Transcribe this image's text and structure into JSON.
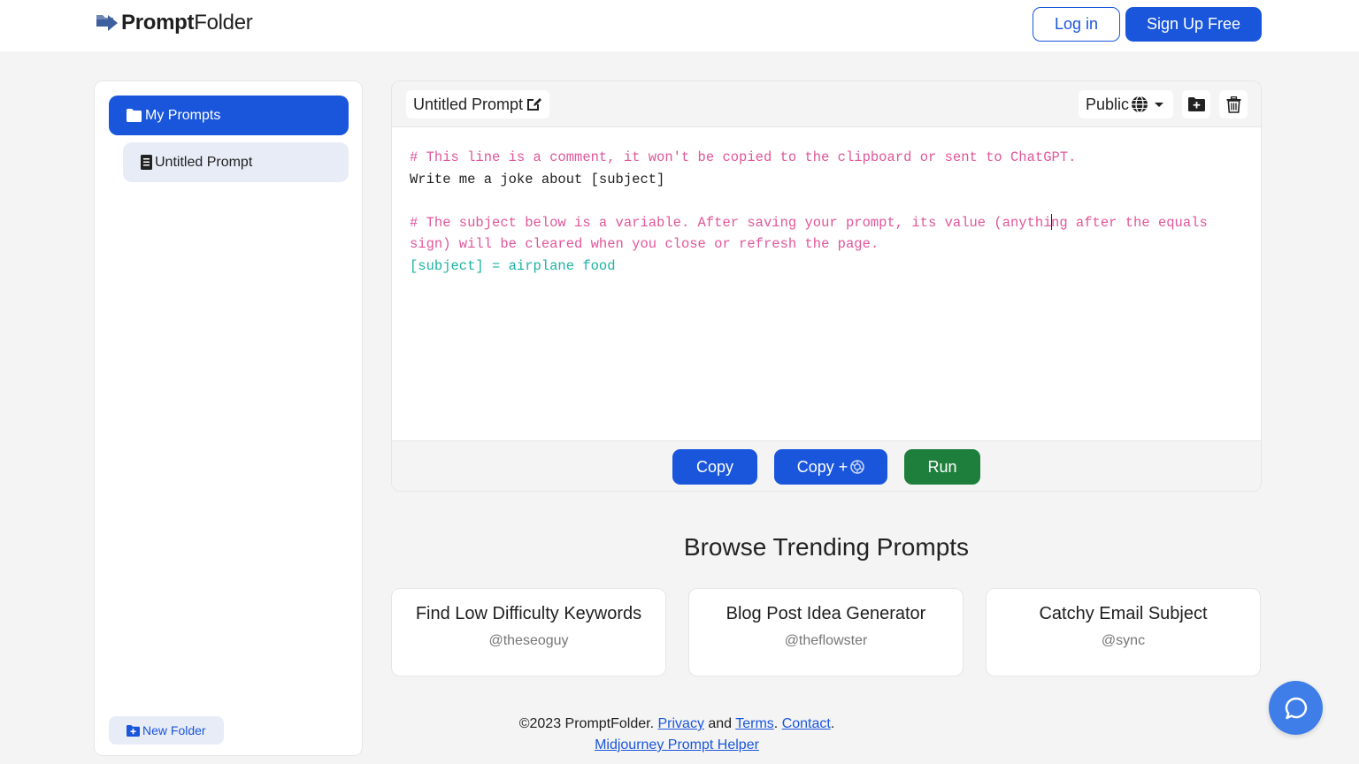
{
  "header": {
    "brand_bold": "Prompt",
    "brand_light": "Folder",
    "login_label": "Log in",
    "signup_label": "Sign Up Free"
  },
  "sidebar": {
    "folder_label": "My Prompts",
    "items": [
      {
        "label": "Untitled Prompt"
      }
    ],
    "new_folder_label": "New Folder"
  },
  "editor": {
    "title": "Untitled Prompt",
    "visibility": "Public",
    "lines": {
      "comment1": "# This line is a comment, it won't be copied to the clipboard or sent to ChatGPT.",
      "prompt": "Write me a joke about [subject]",
      "comment2_a": "# The subject below is a variable. After saving your prompt, its value (anythi",
      "comment2_b": "ng after the equals sign) will be cleared when you close or refresh the page.",
      "variable": "[subject] = airplane food"
    },
    "copy_label": "Copy",
    "copy_plus_label": "Copy +",
    "run_label": "Run"
  },
  "trending": {
    "title": "Browse Trending Prompts",
    "cards": [
      {
        "title": "Find Low Difficulty Keywords",
        "author": "@theseoguy"
      },
      {
        "title": "Blog Post Idea Generator",
        "author": "@theflowster"
      },
      {
        "title": "Catchy Email Subject",
        "author": "@sync"
      }
    ]
  },
  "footer": {
    "copyright": "©2023 PromptFolder. ",
    "privacy": "Privacy",
    "and": " and ",
    "terms": "Terms",
    "dot1": ". ",
    "contact": "Contact",
    "dot2": ".",
    "midjourney": "Midjourney Prompt Helper"
  },
  "colors": {
    "accent": "#1a56db",
    "run": "#1e7f3c",
    "comment": "#e0569a",
    "variable": "#1bb3a4",
    "help_button": "#3f7ee8"
  },
  "icons": {
    "brand": "folder-arrow-icon",
    "title_edit": "pen-to-square-icon",
    "visibility": "globe-icon",
    "dropdown": "caret-down-icon",
    "add_folder": "folder-plus-icon",
    "delete": "trash-icon",
    "folder": "folder-icon",
    "document": "file-icon",
    "chatgpt": "openai-icon",
    "help": "chat-bubble-icon"
  }
}
